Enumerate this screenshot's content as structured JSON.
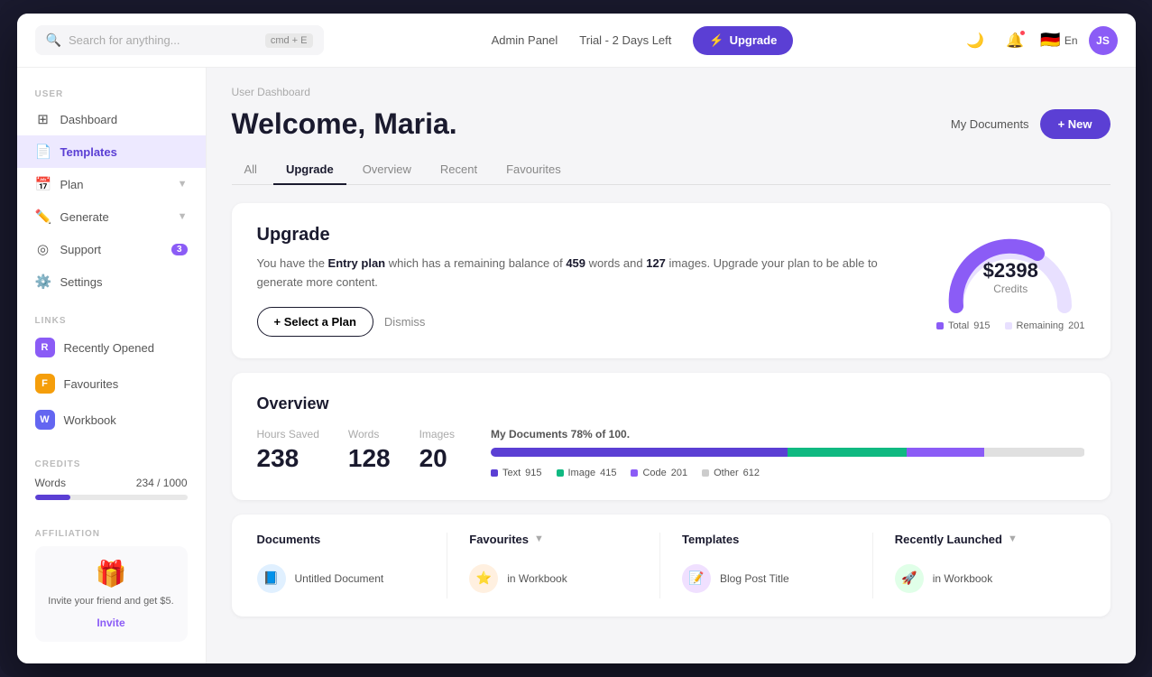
{
  "app": {
    "title": "User Dashboard"
  },
  "topbar": {
    "search_placeholder": "Search for anything...",
    "search_shortcut": "cmd + E",
    "admin_panel": "Admin Panel",
    "trial_label": "Trial - 2 Days Left",
    "upgrade_btn": "Upgrade",
    "lang": "En",
    "avatar_initials": "JS"
  },
  "sidebar": {
    "user_label": "USER",
    "links_label": "LINKS",
    "credits_label": "CREDITS",
    "affiliation_label": "AFFILIATION",
    "nav_items": [
      {
        "id": "dashboard",
        "label": "Dashboard",
        "icon": "⊞",
        "active": false
      },
      {
        "id": "templates",
        "label": "Templates",
        "icon": "📄",
        "active": true
      },
      {
        "id": "plan",
        "label": "Plan",
        "icon": "📅",
        "active": false,
        "arrow": true
      },
      {
        "id": "generate",
        "label": "Generate",
        "icon": "✏️",
        "active": false,
        "arrow": true
      },
      {
        "id": "support",
        "label": "Support",
        "icon": "◎",
        "active": false,
        "badge": "3"
      },
      {
        "id": "settings",
        "label": "Settings",
        "icon": "⚙️",
        "active": false
      }
    ],
    "link_items": [
      {
        "id": "recently-opened",
        "label": "Recently Opened",
        "initial": "R",
        "color": "link-r"
      },
      {
        "id": "favourites",
        "label": "Favourites",
        "initial": "F",
        "color": "link-f"
      },
      {
        "id": "workbook",
        "label": "Workbook",
        "initial": "W",
        "color": "link-w"
      }
    ],
    "credits_words_label": "Words",
    "credits_words_value": "234 / 1000",
    "credits_fill_pct": "23.4",
    "affiliation_text": "Invite your friend and get $5.",
    "affiliation_invite": "Invite"
  },
  "page": {
    "breadcrumb": "User Dashboard",
    "welcome": "Welcome, Maria.",
    "my_documents": "My Documents",
    "new_btn": "+ New"
  },
  "tabs": [
    {
      "id": "all",
      "label": "All",
      "active": false
    },
    {
      "id": "upgrade",
      "label": "Upgrade",
      "active": true
    },
    {
      "id": "overview",
      "label": "Overview",
      "active": false
    },
    {
      "id": "recent",
      "label": "Recent",
      "active": false
    },
    {
      "id": "favourites",
      "label": "Favourites",
      "active": false
    }
  ],
  "upgrade_card": {
    "title": "Upgrade",
    "desc_before": "You have the ",
    "plan_name": "Entry plan",
    "desc_mid": " which has a remaining balance of ",
    "words": "459",
    "desc_mid2": " words and ",
    "images": "127",
    "desc_after": " images. Upgrade your plan to be able to generate more content.",
    "select_plan_btn": "+ Select a Plan",
    "dismiss_btn": "Dismiss",
    "donut_amount": "$2398",
    "donut_label": "Credits",
    "legend_total_label": "Total",
    "legend_total_value": "915",
    "legend_remaining_label": "Remaining",
    "legend_remaining_value": "201"
  },
  "overview_card": {
    "title": "Overview",
    "stats": [
      {
        "label": "Hours Saved",
        "value": "238"
      },
      {
        "label": "Words",
        "value": "128"
      },
      {
        "label": "Images",
        "value": "20"
      }
    ],
    "doc_progress": {
      "label_pre": "My Documents ",
      "pct": "78%",
      "label_post": " of 100.",
      "segments": [
        {
          "label": "Text",
          "value": "915",
          "color": "#5b3fd4"
        },
        {
          "label": "Image",
          "value": "415",
          "color": "#10b981"
        },
        {
          "label": "Code",
          "value": "201",
          "color": "#8b5cf6"
        },
        {
          "label": "Other",
          "value": "612",
          "color": "#e0e0e0"
        }
      ]
    }
  },
  "bottom_section": {
    "columns": [
      {
        "id": "documents",
        "title": "Documents",
        "has_arrow": false
      },
      {
        "id": "favourites",
        "title": "Favourites",
        "has_arrow": true
      },
      {
        "id": "templates",
        "title": "Templates",
        "has_arrow": false
      },
      {
        "id": "recently-launched",
        "title": "Recently Launched",
        "has_arrow": true
      }
    ],
    "doc_item": {
      "name": "Untitled Document",
      "sub": ""
    },
    "fav_item": {
      "name": "in Workbook",
      "sub": ""
    },
    "tmpl_item": {
      "name": "Blog Post Title",
      "sub": ""
    },
    "recent_item": {
      "name": "in Workbook",
      "sub": ""
    }
  }
}
